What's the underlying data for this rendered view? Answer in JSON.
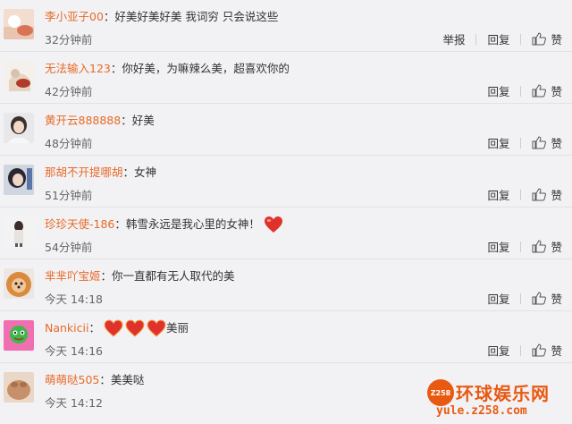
{
  "actions": {
    "report": "举报",
    "reply": "回复",
    "like": "赞"
  },
  "comments": [
    {
      "user": "李小亚子00",
      "sep": "：",
      "text": "好美好美好美 我词穷 只会说这些",
      "time": "32分钟前",
      "hearts": 0,
      "after": ""
    },
    {
      "user": "无法输入123",
      "sep": "：",
      "text": "你好美，为嘛辣么美，超喜欢你的",
      "time": "42分钟前",
      "hearts": 0,
      "after": ""
    },
    {
      "user": "黄开云888888",
      "sep": "：",
      "text": "好美",
      "time": "48分钟前",
      "hearts": 0,
      "after": ""
    },
    {
      "user": "那胡不开提哪胡",
      "sep": "：",
      "text": "女神",
      "time": "51分钟前",
      "hearts": 0,
      "after": ""
    },
    {
      "user": "珍珍天使-186",
      "sep": "：",
      "text": "韩雪永远是我心里的女神！",
      "time": "54分钟前",
      "hearts": 1,
      "after": ""
    },
    {
      "user": "芈芈吖宝姬",
      "sep": "：",
      "text": "你一直都有无人取代的美",
      "time": "今天 14:18",
      "hearts": 0,
      "after": ""
    },
    {
      "user": "Nankicii",
      "sep": "：",
      "text": "",
      "time": "今天 14:16",
      "hearts": 3,
      "after": "美丽"
    },
    {
      "user": "萌萌哒505",
      "sep": "：",
      "text": "美美哒",
      "time": "今天 14:12",
      "hearts": 0,
      "after": ""
    }
  ],
  "colors": {
    "username": "#e86a26",
    "watermark": "#e85a12",
    "heart": "#e0322c"
  },
  "watermark": {
    "badge": "Z258",
    "title": "环球娱乐网",
    "url": "yule.z258.com"
  }
}
